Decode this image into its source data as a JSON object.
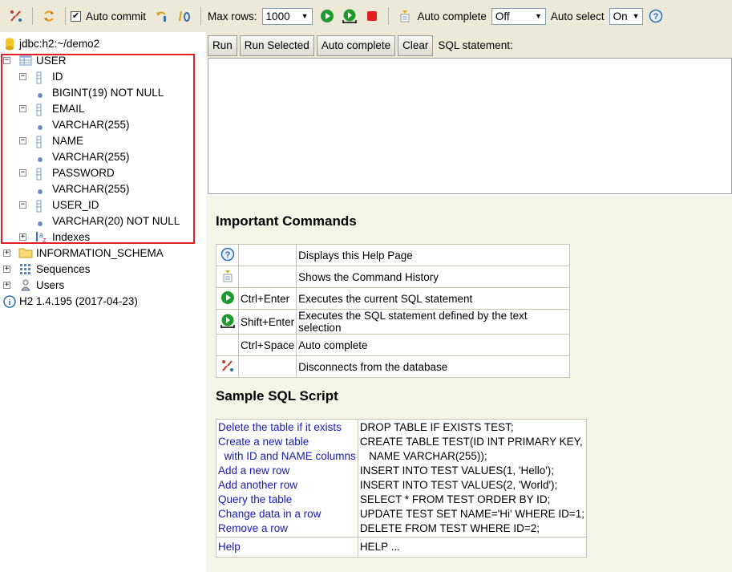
{
  "toolbar": {
    "auto_commit_label": "Auto commit",
    "auto_commit_checked": true,
    "max_rows_label": "Max rows:",
    "max_rows_value": "1000",
    "auto_complete_label": "Auto complete",
    "auto_complete_value": "Off",
    "auto_select_label": "Auto select",
    "auto_select_value": "On",
    "arrow": "▼"
  },
  "tree": {
    "connection": "jdbc:h2:~/demo2",
    "table": "USER",
    "columns": [
      {
        "name": "ID",
        "type": "BIGINT(19) NOT NULL"
      },
      {
        "name": "EMAIL",
        "type": "VARCHAR(255)"
      },
      {
        "name": "NAME",
        "type": "VARCHAR(255)"
      },
      {
        "name": "PASSWORD",
        "type": "VARCHAR(255)"
      },
      {
        "name": "USER_ID",
        "type": "VARCHAR(20) NOT NULL"
      }
    ],
    "indexes": "Indexes",
    "schema": "INFORMATION_SCHEMA",
    "sequences": "Sequences",
    "users": "Users",
    "version": "H2 1.4.195 (2017-04-23)"
  },
  "sqlbar": {
    "run": "Run",
    "run_selected": "Run Selected",
    "auto_complete": "Auto complete",
    "clear": "Clear",
    "statement_label": "SQL statement:"
  },
  "help": {
    "important_title": "Important Commands",
    "commands": [
      {
        "icon": "help-icon",
        "key": "",
        "desc": "Displays this Help Page"
      },
      {
        "icon": "history-icon",
        "key": "",
        "desc": "Shows the Command History"
      },
      {
        "icon": "run-icon",
        "key": "Ctrl+Enter",
        "desc": "Executes the current SQL statement"
      },
      {
        "icon": "run-selected-icon",
        "key": "Shift+Enter",
        "desc": "Executes the SQL statement defined by the text selection"
      },
      {
        "icon": "",
        "key": "Ctrl+Space",
        "desc": "Auto complete"
      },
      {
        "icon": "disconnect-icon",
        "key": "",
        "desc": "Disconnects from the database"
      }
    ],
    "sample_title": "Sample SQL Script",
    "samples": [
      {
        "links": [
          "Delete the table if it exists"
        ],
        "sql": [
          "DROP TABLE IF EXISTS TEST;"
        ]
      },
      {
        "links": [
          "Create a new table",
          "  with ID and NAME columns"
        ],
        "sql": [
          "CREATE TABLE TEST(ID INT PRIMARY KEY,",
          "   NAME VARCHAR(255));"
        ]
      },
      {
        "links": [
          "Add a new row"
        ],
        "sql": [
          "INSERT INTO TEST VALUES(1, 'Hello');"
        ]
      },
      {
        "links": [
          "Add another row"
        ],
        "sql": [
          "INSERT INTO TEST VALUES(2, 'World');"
        ]
      },
      {
        "links": [
          "Query the table"
        ],
        "sql": [
          "SELECT * FROM TEST ORDER BY ID;"
        ]
      },
      {
        "links": [
          "Change data in a row"
        ],
        "sql": [
          "UPDATE TEST SET NAME='Hi' WHERE ID=1;"
        ]
      },
      {
        "links": [
          "Remove a row"
        ],
        "sql": [
          "DELETE FROM TEST WHERE ID=2;"
        ]
      }
    ],
    "help_link": "Help",
    "help_sql": "HELP ..."
  },
  "colors": {
    "toolbar_bg": "#ece9d8",
    "help_bg": "#f5f4e8",
    "highlight": "#e0202a",
    "link": "#1a1ab0",
    "run_green": "#1d9a2e",
    "stop_red": "#e02020"
  }
}
